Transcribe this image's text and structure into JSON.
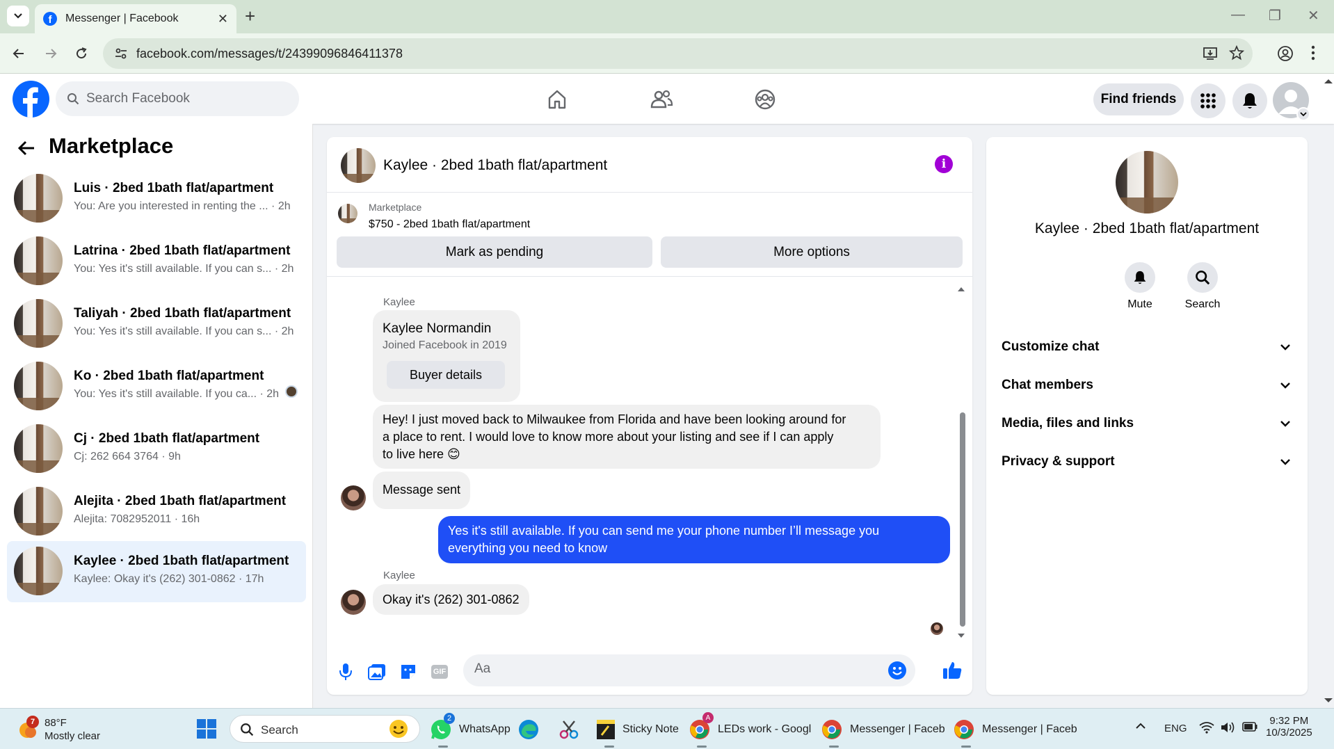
{
  "browser": {
    "tab_title": "Messenger | Facebook",
    "url": "facebook.com/messages/t/24399096846411378"
  },
  "fb": {
    "search_placeholder": "Search Facebook",
    "find_friends": "Find friends"
  },
  "sidebar": {
    "title": "Marketplace",
    "conversations": [
      {
        "name": "Luis · 2bed 1bath flat/apartment",
        "preview": "You: Are you interested in renting the ... · 2h",
        "active": false
      },
      {
        "name": "Latrina · 2bed 1bath flat/apartment",
        "preview": "You: Yes it's still available. If you can s... · 2h",
        "active": false
      },
      {
        "name": "Taliyah · 2bed 1bath flat/apartment",
        "preview": "You: Yes it's still available. If you can s... · 2h",
        "active": false
      },
      {
        "name": "Ko · 2bed 1bath flat/apartment",
        "preview": "You: Yes it's still available. If you ca... · 2h",
        "active": false
      },
      {
        "name": "Cj · 2bed 1bath flat/apartment",
        "preview": "Cj: 262 664 3764 · 9h",
        "active": false
      },
      {
        "name": "Alejita · 2bed 1bath flat/apartment",
        "preview": "Alejita: 7082952011 · 16h",
        "active": false
      },
      {
        "name": "Kaylee · 2bed 1bath flat/apartment",
        "preview": "Kaylee: Okay it's (262) 301-0862 · 17h",
        "active": true
      }
    ]
  },
  "chat": {
    "title": "Kaylee · 2bed 1bath flat/apartment",
    "marketplace_label": "Marketplace",
    "listing": "$750 - 2bed 1bath flat/apartment",
    "mark_pending": "Mark as pending",
    "more_options": "More options",
    "profile_card": {
      "sender": "Kaylee",
      "name": "Kaylee Normandin",
      "joined": "Joined Facebook in 2019",
      "button": "Buyer details"
    },
    "msg1_lines": [
      "Hey! I just moved back to Milwaukee from Florida and have been looking around for",
      "a place to rent. I would love to know more about your listing and see if I can apply",
      "to live here 😊"
    ],
    "msg2": "Message sent",
    "my_msg_lines": [
      "Yes it's still available. If you can send me your phone number I’ll message you",
      "everything you need to know"
    ],
    "sender2": "Kaylee",
    "msg3": "Okay it's (262) 301-0862",
    "input_placeholder": "Aa",
    "icons": [
      "microphone-icon",
      "gallery-icon",
      "sticker-icon",
      "gif-icon",
      "emoji-icon",
      "like-icon"
    ],
    "gif_label": "GIF"
  },
  "info": {
    "name": "Kaylee · 2bed 1bath flat/apartment",
    "mute": "Mute",
    "search": "Search",
    "sections": [
      "Customize chat",
      "Chat members",
      "Media, files and links",
      "Privacy & support"
    ]
  },
  "taskbar": {
    "weather_badge": "7",
    "temp": "88°F",
    "condition": "Mostly clear",
    "search": "Search",
    "apps": [
      {
        "label": "WhatsApp",
        "badge": "2"
      },
      {
        "label": ""
      },
      {
        "label": ""
      },
      {
        "label": "Sticky Note"
      },
      {
        "label": "LEDs work - Googl"
      },
      {
        "label": "Messenger | Faceb"
      },
      {
        "label": "Messenger | Faceb"
      }
    ],
    "lang": "ENG",
    "time": "9:32 PM",
    "date": "10/3/2025"
  },
  "colors": {
    "fb_blue": "#0866ff",
    "my_bubble": "#1f4ff6",
    "info_purple": "#a100d6",
    "active_conv": "#e9f2fd"
  }
}
